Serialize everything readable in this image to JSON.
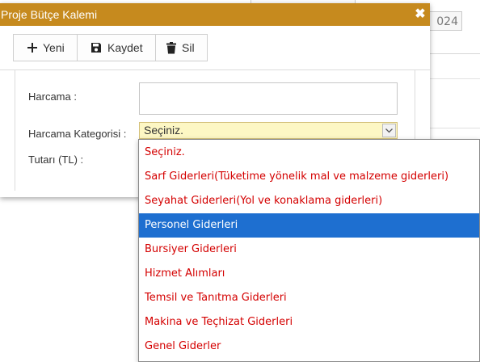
{
  "background": {
    "date_fragment": "024"
  },
  "dialog": {
    "title": "Proje Bütçe Kalemi",
    "close_symbol": "✖"
  },
  "toolbar": {
    "new_label": "Yeni",
    "save_label": "Kaydet",
    "delete_label": "Sil",
    "new_icon": "plus-icon",
    "save_icon": "floppy-disk-icon",
    "delete_icon": "trash-icon"
  },
  "form": {
    "expense_label": "Harcama :",
    "expense_value": "",
    "category_label": "Harcama Kategorisi :",
    "category_selected": "Seçiniz.",
    "amount_label": "Tutarı (TL) :"
  },
  "dropdown": {
    "options": [
      "Seçiniz.",
      "Sarf Giderleri(Tüketime yönelik mal ve malzeme giderleri)",
      "Seyahat Giderleri(Yol ve konaklama giderleri)",
      "Personel Giderleri",
      "Bursiyer Giderleri",
      "Hizmet Alımları",
      "Temsil ve Tanıtma Giderleri",
      "Makina ve Teçhizat Giderleri",
      "Genel Giderler"
    ],
    "highlighted_index": 3
  },
  "colors": {
    "titlebar": "#c68a1e",
    "option_text": "#d40000",
    "highlight": "#1e6fd0",
    "select_bg": "#fdf7c4"
  }
}
